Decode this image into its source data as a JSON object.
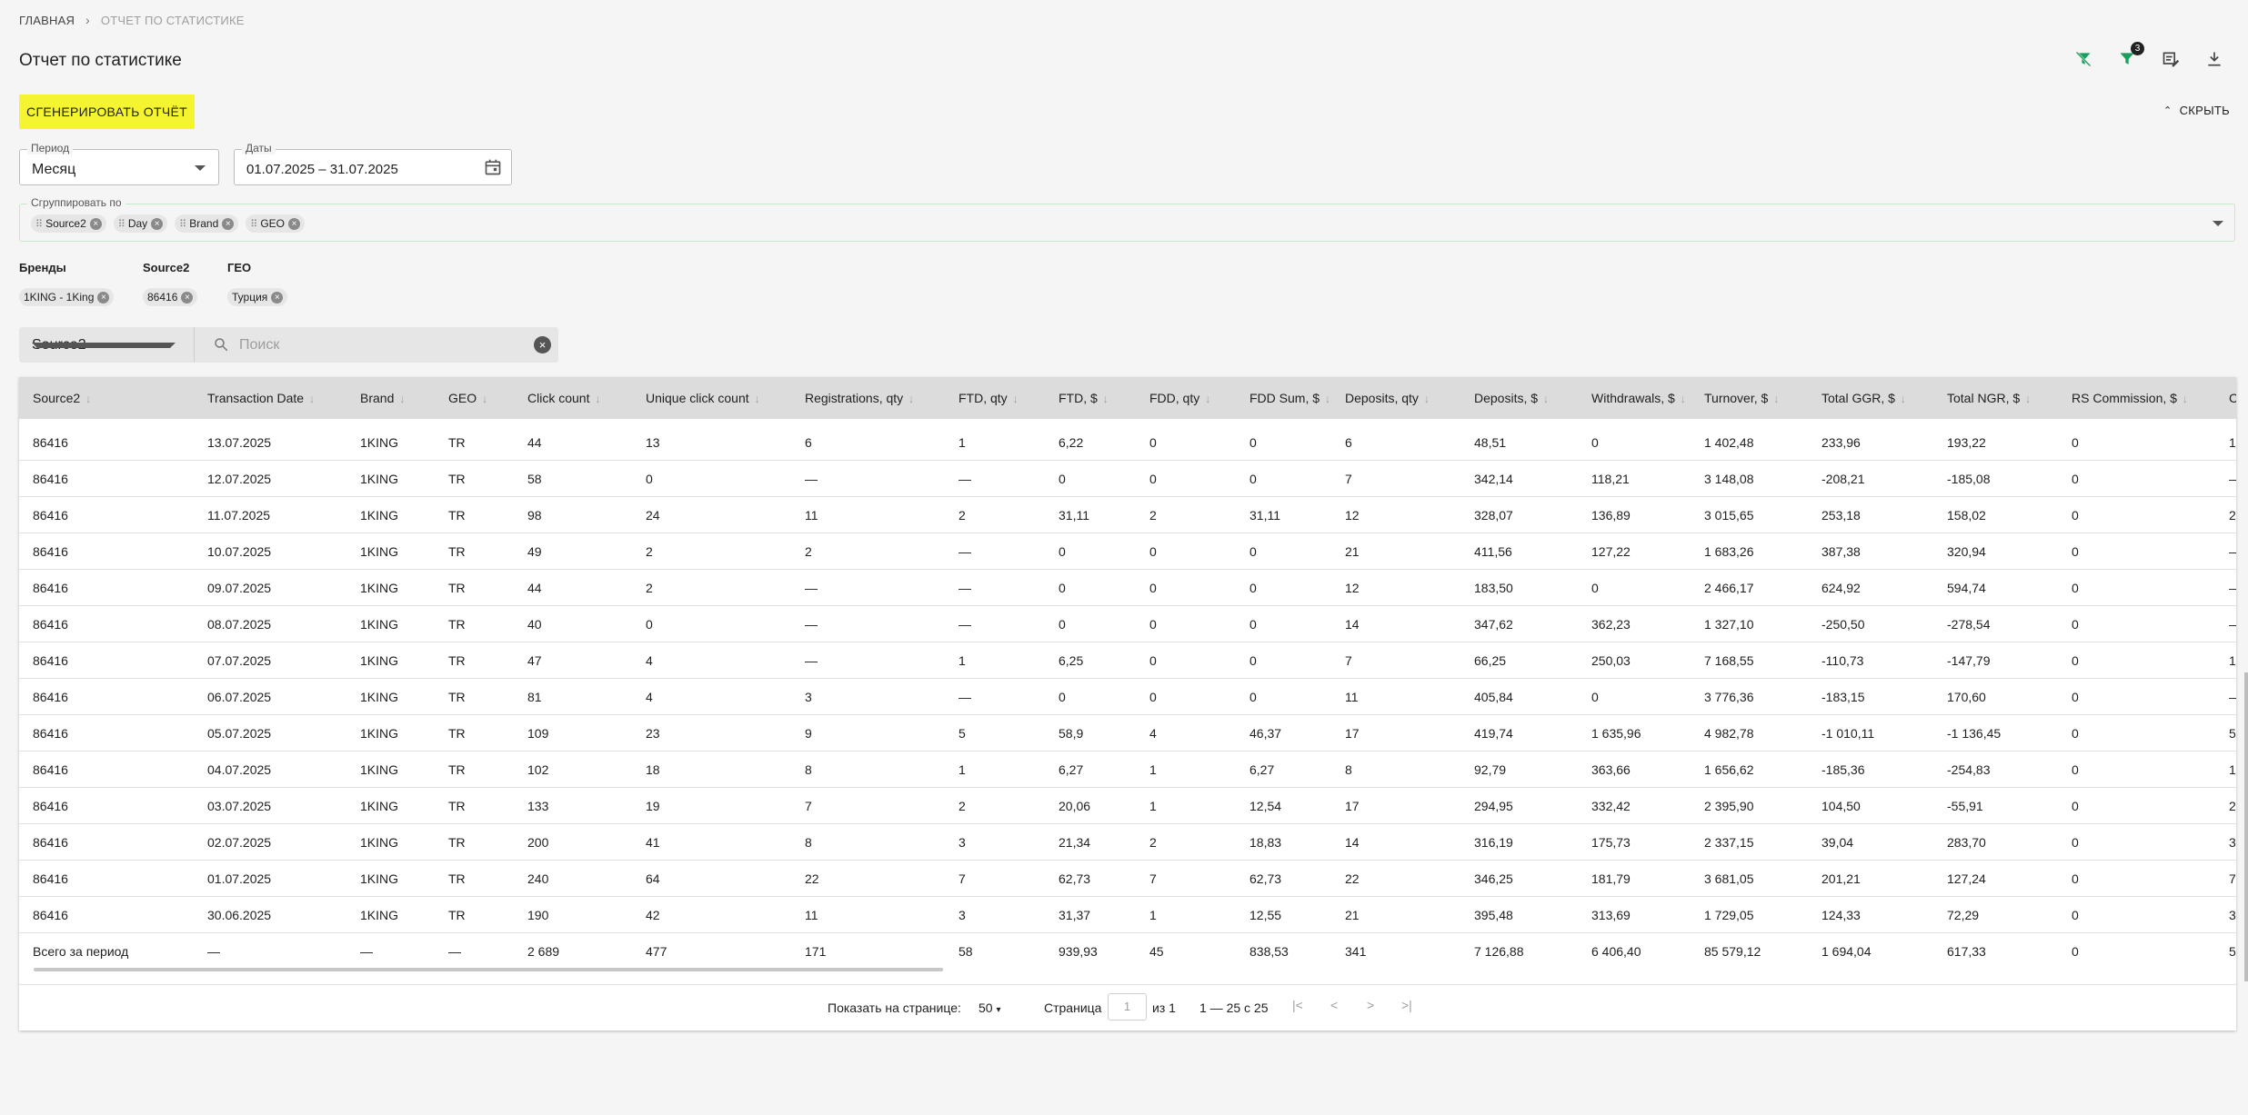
{
  "breadcrumb": {
    "home": "ГЛАВНАЯ",
    "current": "ОТЧЕТ ПО СТАТИСТИКЕ"
  },
  "page_title": "Отчет по статистике",
  "toolbar": {
    "filter_badge": "3"
  },
  "generate_button": "СГЕНЕРИРОВАТЬ ОТЧЁТ",
  "hide_button": "СКРЫТЬ",
  "period": {
    "label": "Период",
    "value": "Месяц"
  },
  "dates": {
    "label": "Даты",
    "value": "01.07.2025 – 31.07.2025"
  },
  "group_by": {
    "label": "Сгруппировать по",
    "chips": [
      "Source2",
      "Day",
      "Brand",
      "GEO"
    ]
  },
  "filters": {
    "brands": {
      "label": "Бренды",
      "chip": "1KING - 1King"
    },
    "source2": {
      "label": "Source2",
      "chip": "86416"
    },
    "geo": {
      "label": "ГЕО",
      "chip": "Турция"
    }
  },
  "search": {
    "field": "Source2",
    "placeholder": "Поиск"
  },
  "table": {
    "headers": [
      "Source2",
      "Transaction Date",
      "Brand",
      "GEO",
      "Click count",
      "Unique click count",
      "Registrations, qty",
      "FTD, qty",
      "FTD, $",
      "FDD, qty",
      "FDD Sum, $",
      "Deposits, qty",
      "Deposits, $",
      "Withdrawals, $",
      "Turnover, $",
      "Total GGR, $",
      "Total NGR, $",
      "RS Commission, $",
      "C"
    ],
    "rows": [
      [
        "86416",
        "13.07.2025",
        "1KING",
        "TR",
        "44",
        "13",
        "6",
        "1",
        "6,22",
        "0",
        "0",
        "6",
        "48,51",
        "0",
        "1 402,48",
        "233,96",
        "193,22",
        "0",
        "1"
      ],
      [
        "86416",
        "12.07.2025",
        "1KING",
        "TR",
        "58",
        "0",
        "—",
        "—",
        "0",
        "0",
        "0",
        "7",
        "342,14",
        "118,21",
        "3 148,08",
        "-208,21",
        "-185,08",
        "0",
        "—"
      ],
      [
        "86416",
        "11.07.2025",
        "1KING",
        "TR",
        "98",
        "24",
        "11",
        "2",
        "31,11",
        "2",
        "31,11",
        "12",
        "328,07",
        "136,89",
        "3 015,65",
        "253,18",
        "158,02",
        "0",
        "2"
      ],
      [
        "86416",
        "10.07.2025",
        "1KING",
        "TR",
        "49",
        "2",
        "2",
        "—",
        "0",
        "0",
        "0",
        "21",
        "411,56",
        "127,22",
        "1 683,26",
        "387,38",
        "320,94",
        "0",
        "—"
      ],
      [
        "86416",
        "09.07.2025",
        "1KING",
        "TR",
        "44",
        "2",
        "—",
        "—",
        "0",
        "0",
        "0",
        "12",
        "183,50",
        "0",
        "2 466,17",
        "624,92",
        "594,74",
        "0",
        "—"
      ],
      [
        "86416",
        "08.07.2025",
        "1KING",
        "TR",
        "40",
        "0",
        "—",
        "—",
        "0",
        "0",
        "0",
        "14",
        "347,62",
        "362,23",
        "1 327,10",
        "-250,50",
        "-278,54",
        "0",
        "—"
      ],
      [
        "86416",
        "07.07.2025",
        "1KING",
        "TR",
        "47",
        "4",
        "—",
        "1",
        "6,25",
        "0",
        "0",
        "7",
        "66,25",
        "250,03",
        "7 168,55",
        "-110,73",
        "-147,79",
        "0",
        "1"
      ],
      [
        "86416",
        "06.07.2025",
        "1KING",
        "TR",
        "81",
        "4",
        "3",
        "—",
        "0",
        "0",
        "0",
        "11",
        "405,84",
        "0",
        "3 776,36",
        "-183,15",
        "170,60",
        "0",
        "—"
      ],
      [
        "86416",
        "05.07.2025",
        "1KING",
        "TR",
        "109",
        "23",
        "9",
        "5",
        "58,9",
        "4",
        "46,37",
        "17",
        "419,74",
        "1 635,96",
        "4 982,78",
        "-1 010,11",
        "-1 136,45",
        "0",
        "5"
      ],
      [
        "86416",
        "04.07.2025",
        "1KING",
        "TR",
        "102",
        "18",
        "8",
        "1",
        "6,27",
        "1",
        "6,27",
        "8",
        "92,79",
        "363,66",
        "1 656,62",
        "-185,36",
        "-254,83",
        "0",
        "1"
      ],
      [
        "86416",
        "03.07.2025",
        "1KING",
        "TR",
        "133",
        "19",
        "7",
        "2",
        "20,06",
        "1",
        "12,54",
        "17",
        "294,95",
        "332,42",
        "2 395,90",
        "104,50",
        "-55,91",
        "0",
        "2"
      ],
      [
        "86416",
        "02.07.2025",
        "1KING",
        "TR",
        "200",
        "41",
        "8",
        "3",
        "21,34",
        "2",
        "18,83",
        "14",
        "316,19",
        "175,73",
        "2 337,15",
        "39,04",
        "283,70",
        "0",
        "3"
      ],
      [
        "86416",
        "01.07.2025",
        "1KING",
        "TR",
        "240",
        "64",
        "22",
        "7",
        "62,73",
        "7",
        "62,73",
        "22",
        "346,25",
        "181,79",
        "3 681,05",
        "201,21",
        "127,24",
        "0",
        "7"
      ],
      [
        "86416",
        "30.06.2025",
        "1KING",
        "TR",
        "190",
        "42",
        "11",
        "3",
        "31,37",
        "1",
        "12,55",
        "21",
        "395,48",
        "313,69",
        "1 729,05",
        "124,33",
        "72,29",
        "0",
        "3"
      ]
    ],
    "totals": [
      "Всего за период",
      "—",
      "—",
      "—",
      "2 689",
      "477",
      "171",
      "58",
      "939,93",
      "45",
      "838,53",
      "341",
      "7 126,88",
      "6 406,40",
      "85 579,12",
      "1 694,04",
      "617,33",
      "0",
      "5"
    ]
  },
  "paginator": {
    "per_page_label": "Показать на странице:",
    "per_page_value": "50",
    "page_label": "Страница",
    "page_value": "1",
    "of_label": "из 1",
    "range_label": "1 — 25 с 25"
  }
}
